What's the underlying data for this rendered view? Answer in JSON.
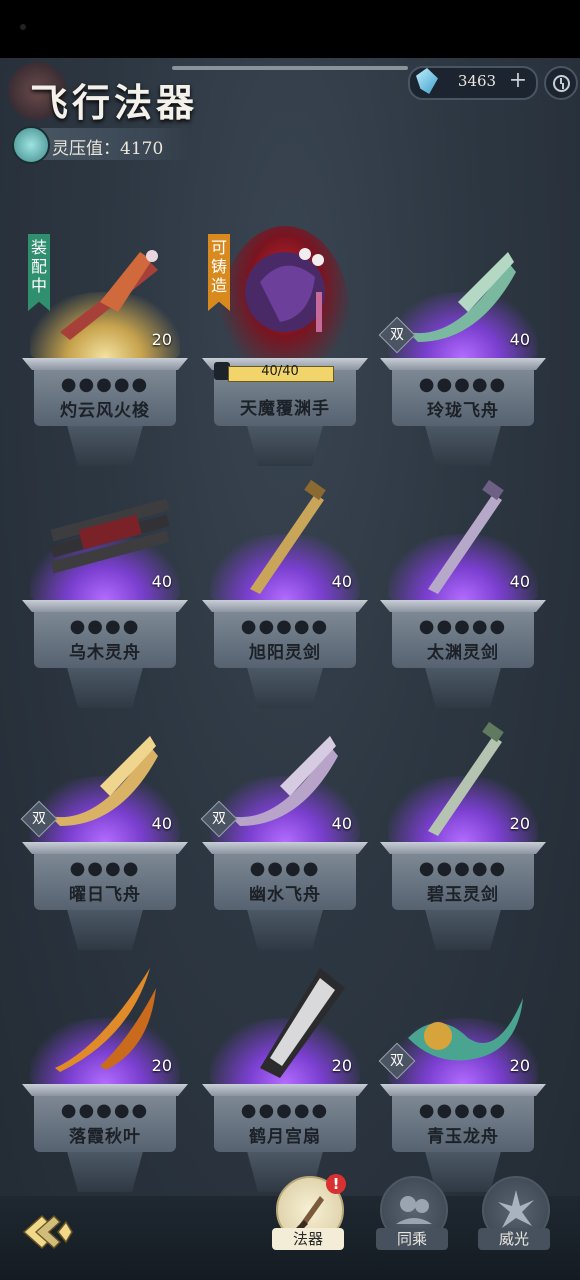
{
  "header": {
    "title": "飞行法器",
    "spirit_pressure": "灵压值：4170",
    "currency": "3463",
    "plus": "+"
  },
  "items": [
    {
      "name": "灼云风火梭",
      "level": "20",
      "tag": "装配中",
      "tag_color": "#2f8f6e",
      "dual": false,
      "marks": "●●●●●",
      "glow": "gold",
      "art": "sword-red"
    },
    {
      "name": "天魔覆渊手",
      "level": "",
      "tag": "可铸造",
      "tag_color": "#d88a1f",
      "dual": false,
      "marks": "",
      "progress": "40/40",
      "progress_value": 1.0,
      "glow": "red",
      "art": "hand"
    },
    {
      "name": "玲珑飞舟",
      "level": "40",
      "tag": "",
      "dual": true,
      "dual_label": "双",
      "marks": "●●●●●",
      "glow": "purple",
      "art": "boat-green"
    },
    {
      "name": "乌木灵舟",
      "level": "40",
      "tag": "",
      "dual": false,
      "marks": "●●●●",
      "glow": "purple",
      "art": "raft"
    },
    {
      "name": "旭阳灵剑",
      "level": "40",
      "tag": "",
      "dual": false,
      "marks": "●●●●●",
      "glow": "purple",
      "art": "sword-gold"
    },
    {
      "name": "太渊灵剑",
      "level": "40",
      "tag": "",
      "dual": false,
      "marks": "●●●●●",
      "glow": "purple",
      "art": "sword-purple"
    },
    {
      "name": "曜日飞舟",
      "level": "40",
      "tag": "",
      "dual": true,
      "dual_label": "双",
      "marks": "●●●●",
      "glow": "purple",
      "art": "boat-gold"
    },
    {
      "name": "幽水飞舟",
      "level": "40",
      "tag": "",
      "dual": true,
      "dual_label": "双",
      "marks": "●●●●",
      "glow": "purple",
      "art": "boat-purple"
    },
    {
      "name": "碧玉灵剑",
      "level": "20",
      "tag": "",
      "dual": false,
      "marks": "●●●●●",
      "glow": "purple",
      "art": "sword-green"
    },
    {
      "name": "落霞秋叶",
      "level": "20",
      "tag": "",
      "dual": false,
      "marks": "●●●●●",
      "glow": "purple",
      "art": "leaf"
    },
    {
      "name": "鹤月宫扇",
      "level": "20",
      "tag": "",
      "dual": false,
      "marks": "●●●●●",
      "glow": "purple",
      "art": "fan"
    },
    {
      "name": "青玉龙舟",
      "level": "20",
      "tag": "",
      "dual": true,
      "dual_label": "双",
      "marks": "●●●●●",
      "glow": "purple",
      "art": "dragon"
    }
  ],
  "nav": [
    {
      "label": "法器",
      "active": true,
      "icon": "artifact-icon"
    },
    {
      "label": "同乘",
      "active": false,
      "icon": "ride-together-icon"
    },
    {
      "label": "威光",
      "active": false,
      "icon": "aura-icon"
    }
  ],
  "alert_badge": "!"
}
